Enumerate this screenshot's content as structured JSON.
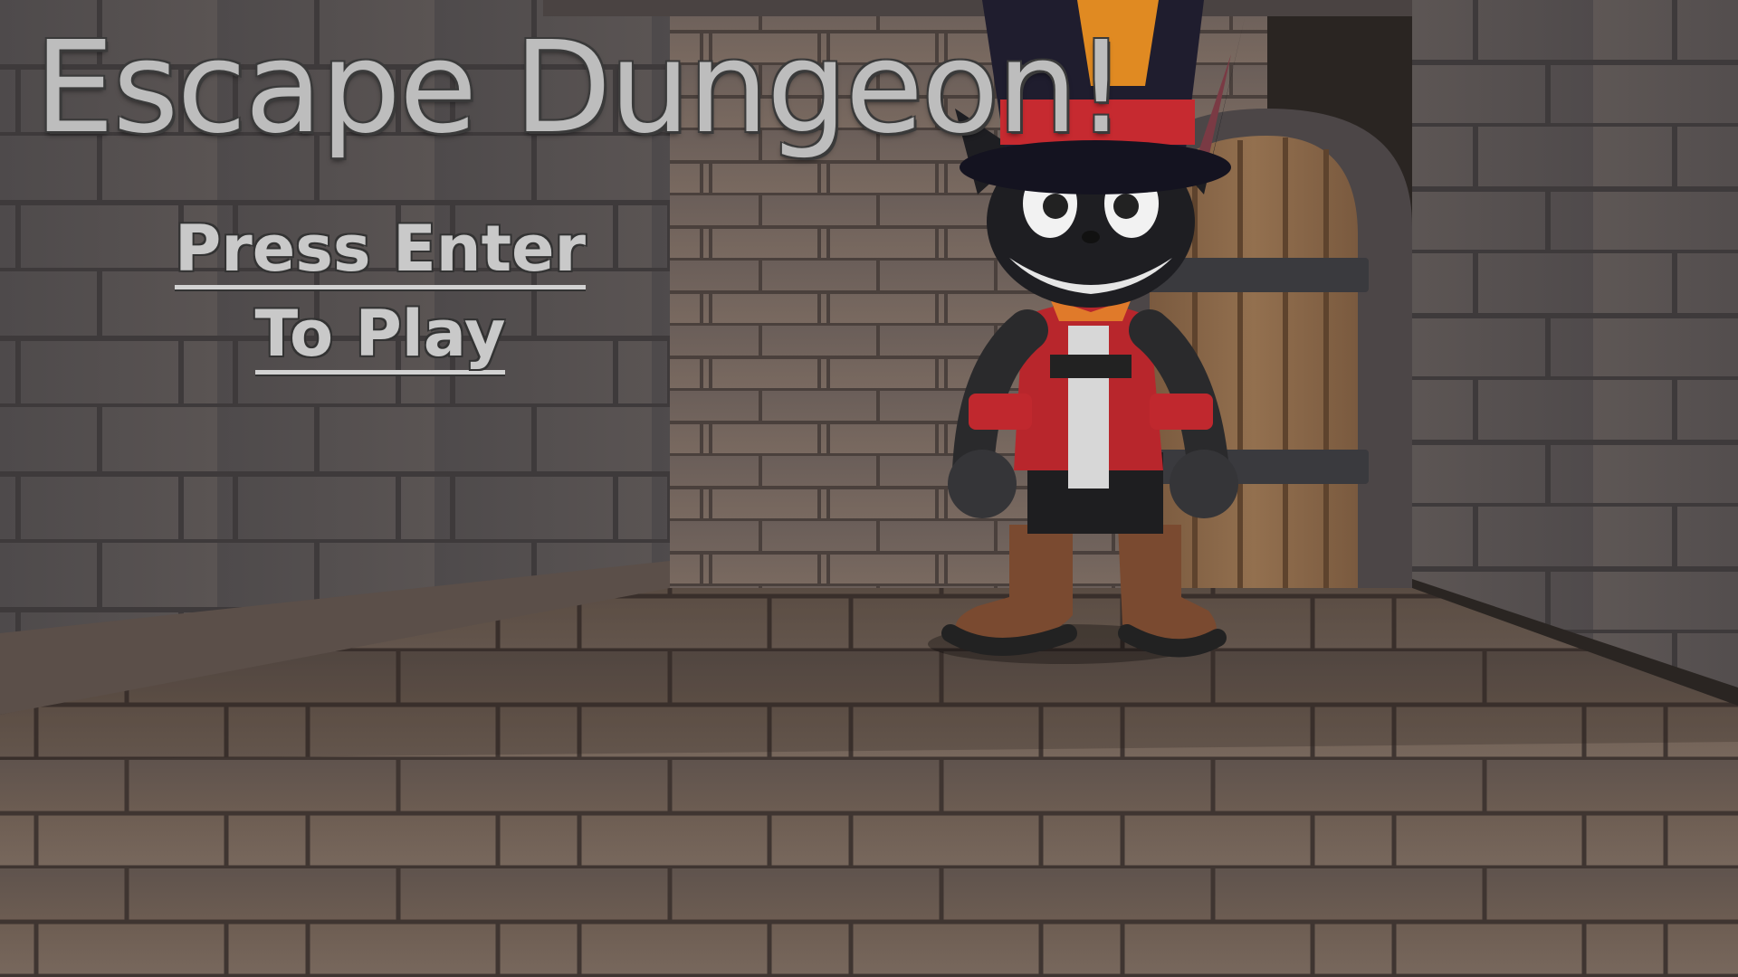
{
  "title": "Escape Dungeon!",
  "prompt": {
    "line1": "Press Enter",
    "line2": "To Play"
  },
  "colors": {
    "title_text": "#bdbdbd",
    "prompt_text": "#c9c9c9",
    "wall_stone": "#5c5655",
    "floor_stone": "#6a5a50",
    "door_wood": "#8a6444",
    "character_red": "#c0282e"
  }
}
